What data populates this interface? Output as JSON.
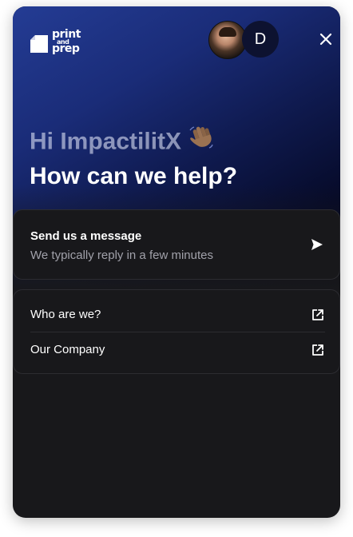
{
  "widget": {
    "colors": {
      "background": "#18181b",
      "hero_gradient_start": "#243c94",
      "hero_gradient_end": "#050714",
      "muted_text": "#a1a1aa",
      "border": "#2c2c31"
    }
  },
  "header": {
    "logo": {
      "line1": "print",
      "line2": "and",
      "line3": "prep",
      "icon": "print-and-prep-logo"
    },
    "team_avatars": [
      {
        "type": "photo",
        "icon": "team-member-photo"
      },
      {
        "type": "initial",
        "initial": "D"
      }
    ],
    "close_icon": "close-icon"
  },
  "greeting": {
    "hi_text": "Hi ImpactilitX",
    "wave_icon": "waving-hand-icon",
    "help_text": "How can we help?"
  },
  "message_card": {
    "title": "Send us a message",
    "subtitle": "We typically reply in a few minutes",
    "icon": "send-icon"
  },
  "links": [
    {
      "label": "Who are we?",
      "icon": "external-link-icon"
    },
    {
      "label": "Our Company",
      "icon": "external-link-icon"
    }
  ]
}
